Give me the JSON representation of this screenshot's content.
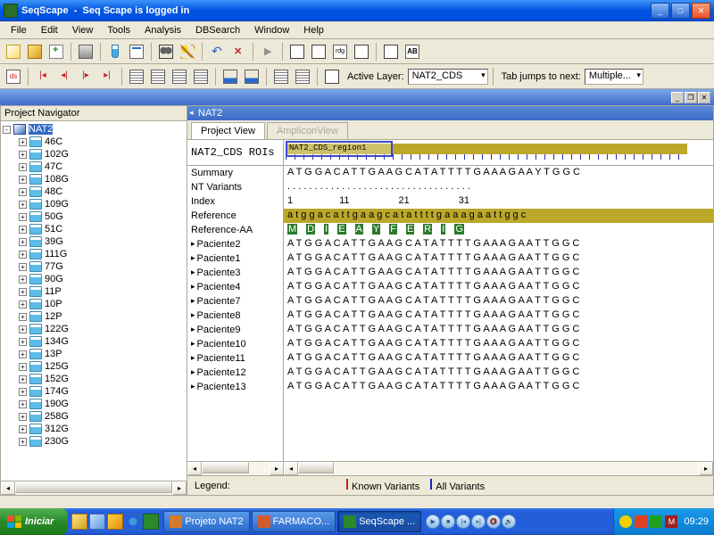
{
  "app": {
    "name": "SeqScape",
    "title_suffix": "Seq Scape is logged in"
  },
  "menu": [
    "File",
    "Edit",
    "View",
    "Tools",
    "Analysis",
    "DBSearch",
    "Window",
    "Help"
  ],
  "toolbar2": {
    "active_layer_label": "Active Layer:",
    "active_layer_value": "NAT2_CDS",
    "tab_jumps_label": "Tab jumps to next:",
    "tab_jumps_value": "Multiple..."
  },
  "navigator": {
    "title": "Project Navigator",
    "root": "NAT2",
    "samples": [
      "46C",
      "102G",
      "47C",
      "108G",
      "48C",
      "109G",
      "50G",
      "51C",
      "39G",
      "111G",
      "77G",
      "90G",
      "11P",
      "10P",
      "12P",
      "122G",
      "134G",
      "13P",
      "125G",
      "152G",
      "174G",
      "190G",
      "258G",
      "312G",
      "230G"
    ]
  },
  "main": {
    "title": "NAT2",
    "tabs": [
      {
        "label": "Project View",
        "active": true
      },
      {
        "label": "AmpliconView",
        "active": false
      }
    ],
    "rois_label": "NAT2_CDS ROIs",
    "rois_region": "NAT2_CDS_region1",
    "fixed_rows": {
      "summary": "Summary",
      "nt_variants": "NT Variants",
      "index": "Index",
      "reference": "Reference",
      "reference_aa": "Reference-AA"
    },
    "patient_rows": [
      "Paciente2",
      "Paciente1",
      "Paciente3",
      "Paciente4",
      "Paciente7",
      "Paciente8",
      "Paciente9",
      "Paciente10",
      "Paciente11",
      "Paciente12",
      "Paciente13"
    ],
    "seq": {
      "summary": "A T G G A C A T T G A A G C A T A T T T T G A A A G A A Y T G G C",
      "nt_variants": ". . . . . . . . . . . . . . . . . . . . . . . . . . . . . . . . . .",
      "index": "1                 11                  21                  31",
      "reference": "a t g g a c a t t g a a g c a t a t t t t g a a a g a a t t g g c",
      "reference_aa": [
        "M",
        "D",
        "I",
        "E",
        "A",
        "Y",
        "F",
        "E",
        "R",
        "I",
        "G"
      ],
      "patient": "A T G G A C A T T G A A G C A T A T T T T G A A A G A A T T G G C"
    }
  },
  "legend": {
    "label": "Legend:",
    "known": "Known Variants",
    "all": "All Variants",
    "known_color": "#c02020",
    "all_color": "#2020c0"
  },
  "taskbar": {
    "start": "Iniciar",
    "tasks": [
      {
        "label": "Projeto NAT2",
        "active": false,
        "icon_color": "#d47a2a"
      },
      {
        "label": "FARMACO...",
        "active": false,
        "icon_color": "#d45a2a"
      },
      {
        "label": "SeqScape ...",
        "active": true,
        "icon_color": "#2a8a2a"
      }
    ],
    "clock": "09:29"
  }
}
